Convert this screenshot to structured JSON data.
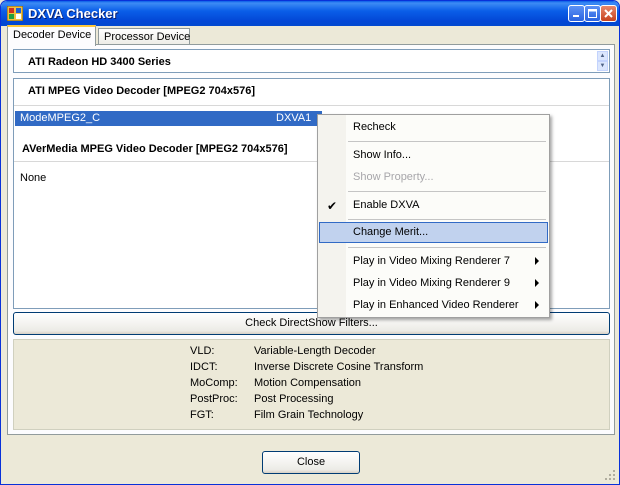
{
  "window": {
    "title": "DXVA Checker"
  },
  "tabs": [
    {
      "label": "Decoder Device",
      "active": true
    },
    {
      "label": "Processor Device",
      "active": false
    }
  ],
  "device": {
    "selected": "ATI Radeon HD 3400 Series"
  },
  "decoders": [
    {
      "header": "ATI MPEG Video Decoder  [MPEG2 704x576]",
      "mode": "ModeMPEG2_C",
      "type": "DXVA1"
    },
    {
      "header": "AVerMedia MPEG Video Decoder  [MPEG2 704x576]",
      "mode": "None"
    }
  ],
  "check_button": {
    "label": "Check DirectShow Filters..."
  },
  "legend": [
    {
      "key": "VLD:",
      "value": "Variable-Length Decoder"
    },
    {
      "key": "IDCT:",
      "value": "Inverse Discrete Cosine Transform"
    },
    {
      "key": "MoComp:",
      "value": "Motion Compensation"
    },
    {
      "key": "PostProc:",
      "value": "Post Processing"
    },
    {
      "key": "FGT:",
      "value": "Film Grain Technology"
    }
  ],
  "close_button": {
    "label": "Close"
  },
  "context_menu": {
    "items": {
      "recheck": "Recheck",
      "show_info": "Show Info...",
      "show_property": "Show Property...",
      "enable_dxva": "Enable DXVA",
      "change_merit": "Change Merit...",
      "play_vmr7": "Play in Video Mixing Renderer 7",
      "play_vmr9": "Play in Video Mixing Renderer 9",
      "play_evr": "Play in Enhanced Video Renderer"
    }
  },
  "colors": {
    "titlebar": "#0a5ee8",
    "selection": "#316ac5",
    "menu_hover": "#c1d2ee",
    "tab_accent": "#ffc83c"
  }
}
